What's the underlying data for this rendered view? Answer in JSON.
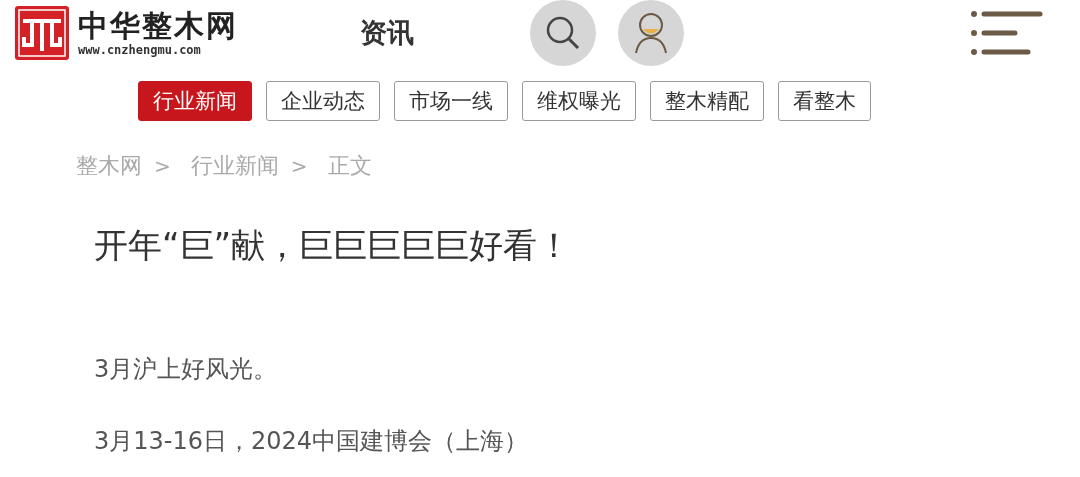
{
  "header": {
    "site_name": "中华整木网",
    "site_url": "www.cnzhengmu.com",
    "section_title": "资讯"
  },
  "category_tabs": [
    {
      "label": "行业新闻",
      "selected": true
    },
    {
      "label": "企业动态",
      "selected": false
    },
    {
      "label": "市场一线",
      "selected": false
    },
    {
      "label": "维权曝光",
      "selected": false
    },
    {
      "label": "整木精配",
      "selected": false
    },
    {
      "label": "看整木",
      "selected": false
    }
  ],
  "breadcrumb": [
    {
      "label": "整木网",
      "separator": ">"
    },
    {
      "label": "行业新闻",
      "separator": ">"
    },
    {
      "label": "正文"
    }
  ],
  "article": {
    "title": "开年“巨”献，巨巨巨巨巨好看！",
    "paragraphs": [
      "3月沪上好风光。",
      "3月13-16日，2024中国建博会（上海）"
    ]
  }
}
